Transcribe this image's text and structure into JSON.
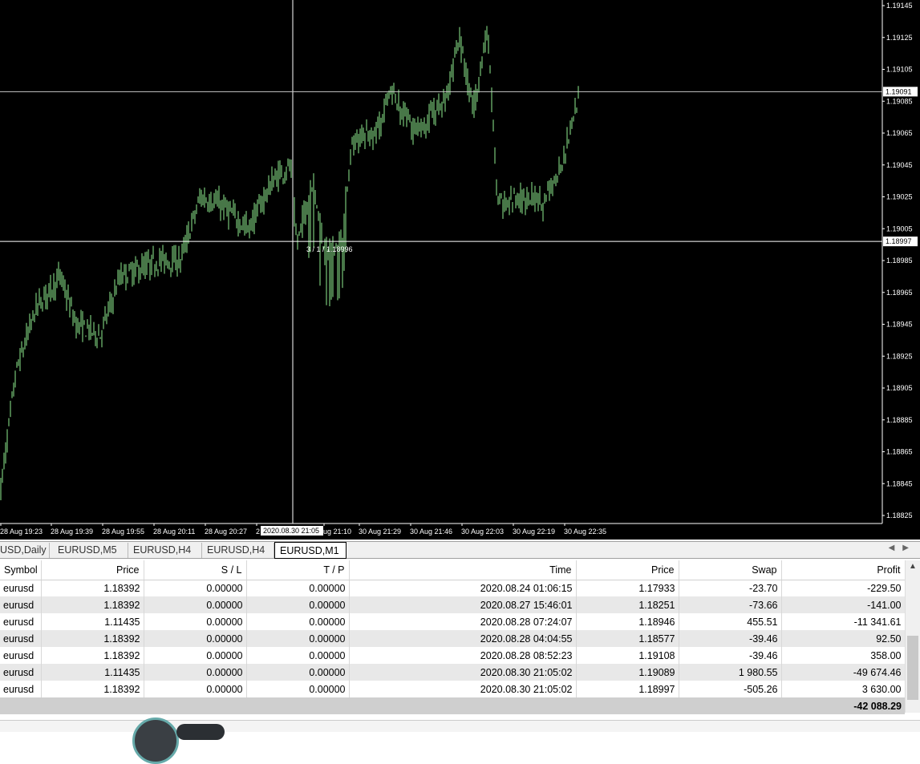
{
  "chart": {
    "price_labels": [
      "1.19145",
      "1.19125",
      "1.19105",
      "1.19085",
      "1.19065",
      "1.19045",
      "1.19025",
      "1.19005",
      "1.18985",
      "1.18965",
      "1.18945",
      "1.18925",
      "1.18905",
      "1.18885",
      "1.18865",
      "1.18845",
      "1.18825"
    ],
    "time_labels": [
      "28 Aug 19:23",
      "28 Aug 19:39",
      "28 Aug 19:55",
      "28 Aug 20:11",
      "28 Aug 20:27",
      "2",
      "ug 21:10",
      "30 Aug 21:29",
      "30 Aug 21:46",
      "30 Aug 22:03",
      "30 Aug 22:19",
      "30 Aug 22:35"
    ],
    "crosshair_time": "2020.08.30 21:05",
    "crosshair_price": "1.18997",
    "crosshair_info": "3 / 1 / 1.18996",
    "line_price": "1.19091",
    "colors": {
      "background": "#000000",
      "candle": "#90ee90",
      "grid_line": "#ffffff"
    }
  },
  "tabs": [
    {
      "label": "USD,Daily"
    },
    {
      "label": "EURUSD,M5"
    },
    {
      "label": "EURUSD,H4"
    },
    {
      "label": "EURUSD,H4"
    },
    {
      "label": "EURUSD,M1",
      "active": true
    }
  ],
  "table": {
    "headers": [
      "Symbol",
      "Price",
      "S / L",
      "T / P",
      "Time",
      "Price",
      "Swap",
      "Profit"
    ],
    "rows": [
      [
        "eurusd",
        "1.18392",
        "0.00000",
        "0.00000",
        "2020.08.24 01:06:15",
        "1.17933",
        "-23.70",
        "-229.50"
      ],
      [
        "eurusd",
        "1.18392",
        "0.00000",
        "0.00000",
        "2020.08.27 15:46:01",
        "1.18251",
        "-73.66",
        "-141.00"
      ],
      [
        "eurusd",
        "1.11435",
        "0.00000",
        "0.00000",
        "2020.08.28 07:24:07",
        "1.18946",
        "455.51",
        "-11 341.61"
      ],
      [
        "eurusd",
        "1.18392",
        "0.00000",
        "0.00000",
        "2020.08.28 04:04:55",
        "1.18577",
        "-39.46",
        "92.50"
      ],
      [
        "eurusd",
        "1.18392",
        "0.00000",
        "0.00000",
        "2020.08.28 08:52:23",
        "1.19108",
        "-39.46",
        "358.00"
      ],
      [
        "eurusd",
        "1.11435",
        "0.00000",
        "0.00000",
        "2020.08.30 21:05:02",
        "1.19089",
        "1 980.55",
        "-49 674.46"
      ],
      [
        "eurusd",
        "1.18392",
        "0.00000",
        "0.00000",
        "2020.08.30 21:05:02",
        "1.18997",
        "-505.26",
        "3 630.00"
      ]
    ],
    "total_profit": "-42 088.29"
  }
}
